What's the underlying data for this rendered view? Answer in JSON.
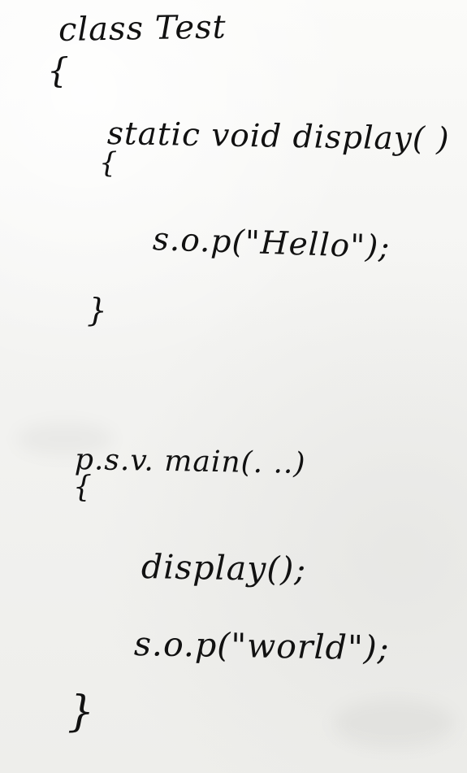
{
  "whiteboard": {
    "code_lines": [
      "class Test",
      "{",
      "static void display( )",
      "{",
      "s.o.p(\"Hello\");",
      "}",
      "p.s.v. main(. ..)",
      "{",
      "display();",
      "s.o.p(\"world\");",
      "}"
    ]
  }
}
